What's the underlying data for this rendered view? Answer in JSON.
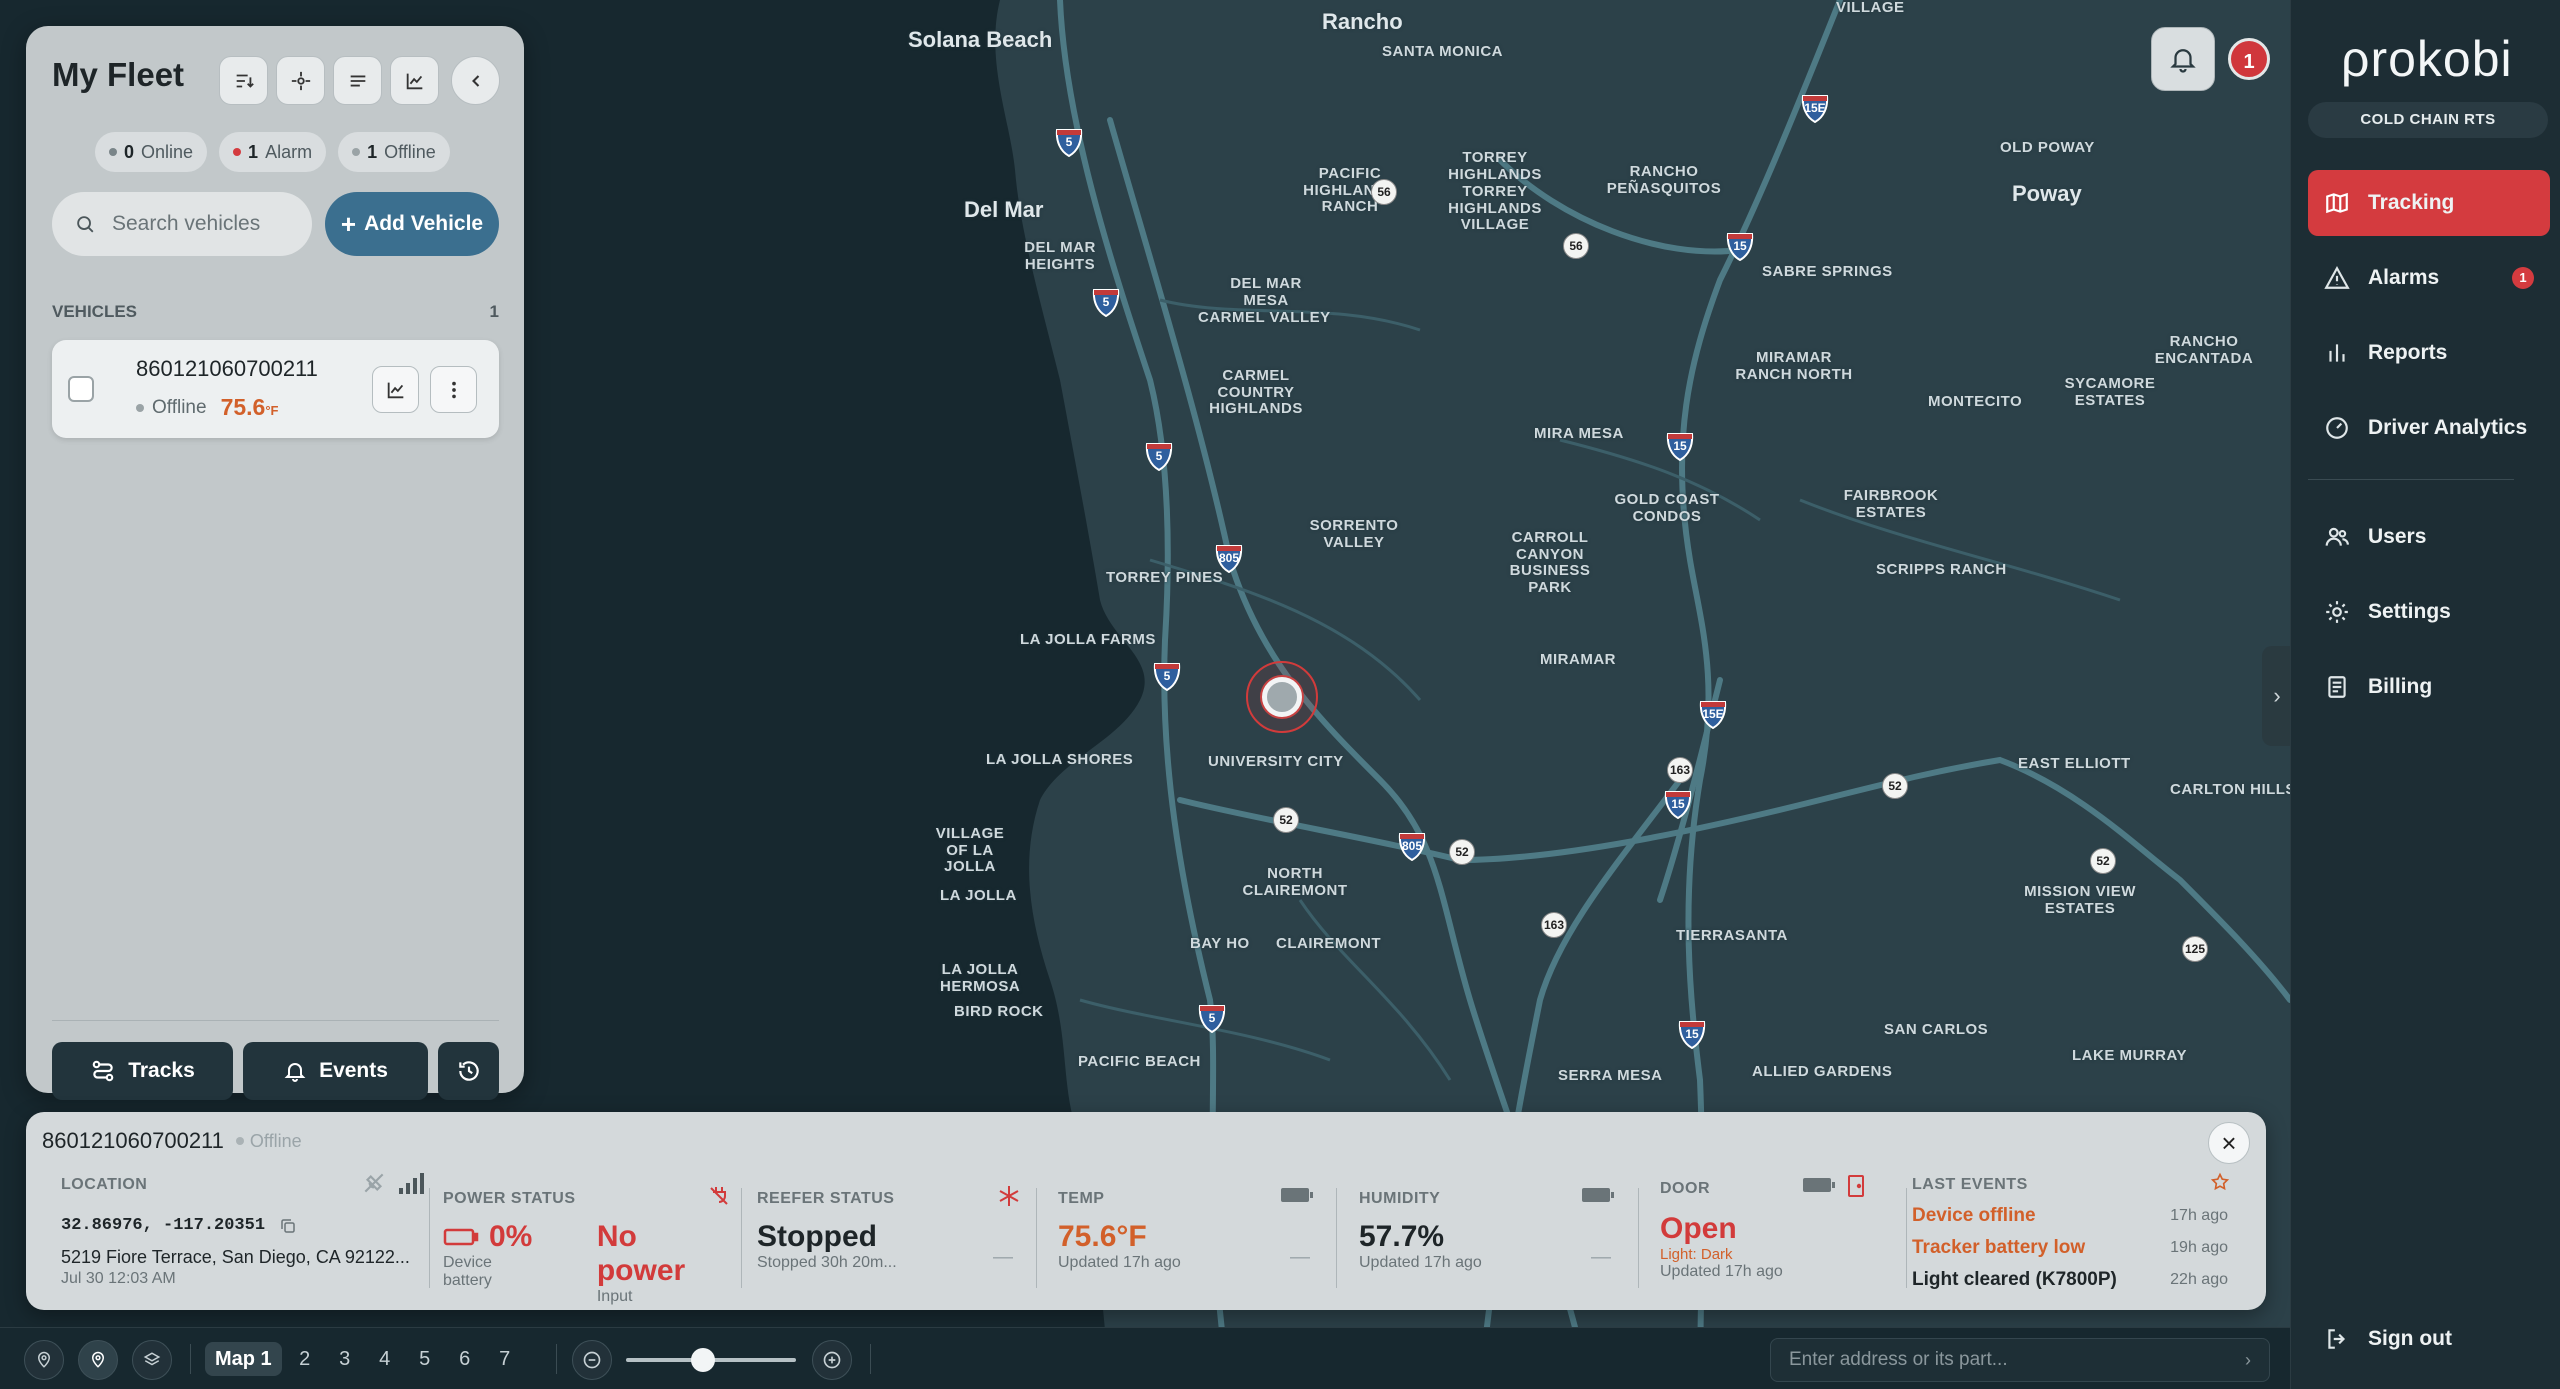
{
  "map": {
    "labels": [
      "Solana Beach",
      "Del Mar",
      "Rancho",
      "Santa Monica",
      "Pacific Highlands Ranch",
      "Torrey Highlands",
      "Torrey Highlands Village",
      "Rancho Peñasquitos",
      "Old Poway",
      "Poway",
      "Del Mar Heights",
      "Del Mar Mesa",
      "Carmel Valley",
      "Sabre Springs",
      "Rancho Encantada",
      "Miramar Ranch North",
      "Carmel Country Highlands",
      "Montecito",
      "Sycamore Estates",
      "Mira Mesa",
      "Gold Coast Condos",
      "Fairbrook Estates",
      "Sorrento Valley",
      "Carroll Canyon Business Park",
      "Torrey Pines",
      "Scripps Ranch",
      "La Jolla Farms",
      "Miramar",
      "La Jolla Shores",
      "University City",
      "East Elliott",
      "Carlton Hills",
      "Village of La Jolla",
      "North Clairemont",
      "Mission View Estates",
      "La Jolla",
      "Bay Ho",
      "Clairemont",
      "Tierrasanta",
      "La Jolla Hermosa",
      "Bird Rock",
      "San Carlos",
      "Pacific Beach",
      "Serra Mesa",
      "Allied Gardens",
      "Lake Murray",
      "Village"
    ],
    "interstates": [
      "5",
      "5",
      "5",
      "5",
      "5",
      "805",
      "805",
      "15",
      "15",
      "15",
      "15",
      "15E",
      "15E",
      "15E"
    ],
    "routes": [
      "56",
      "56",
      "163",
      "163",
      "52",
      "52",
      "52",
      "52",
      "125"
    ]
  },
  "header": {
    "alarm_count": "1"
  },
  "fleet": {
    "title": "My Fleet",
    "status": {
      "online_count": "0",
      "online_label": "Online",
      "alarm_count": "1",
      "alarm_label": "Alarm",
      "offline_count": "1",
      "offline_label": "Offline"
    },
    "search_placeholder": "Search vehicles",
    "add_label": "Add Vehicle",
    "section_label": "VEHICLES",
    "section_count": "1",
    "vehicles": [
      {
        "id": "860121060700211",
        "status": "Offline",
        "temp": "75.6",
        "temp_unit": "°F"
      }
    ],
    "tracks_label": "Tracks",
    "events_label": "Events"
  },
  "detail": {
    "title": "860121060700211",
    "status": "Offline",
    "location": {
      "label": "LOCATION",
      "coords": "32.86976, -117.20351",
      "address": "5219 Fiore Terrace, San Diego, CA 92122...",
      "time": "Jul 30 12:03 AM"
    },
    "power": {
      "label": "POWER STATUS",
      "battery_value": "0%",
      "battery_sub": "Device battery",
      "input_value": "No power",
      "input_sub": "Input"
    },
    "reefer": {
      "label": "REEFER STATUS",
      "value": "Stopped",
      "sub": "Stopped 30h 20m..."
    },
    "temp": {
      "label": "TEMP",
      "value": "75.6°F",
      "sub": "Updated 17h ago"
    },
    "humidity": {
      "label": "HUMIDITY",
      "value": "57.7%",
      "sub": "Updated 17h ago"
    },
    "door": {
      "label": "DOOR",
      "value": "Open",
      "light": "Light: Dark",
      "sub": "Updated 17h ago"
    },
    "events": {
      "label": "LAST EVENTS",
      "items": [
        {
          "text": "Device offline",
          "ago": "17h ago",
          "color": "#d2602a"
        },
        {
          "text": "Tracker battery low",
          "ago": "19h ago",
          "color": "#d2602a"
        },
        {
          "text": "Light cleared (K7800P)",
          "ago": "22h ago",
          "color": "#1e2528"
        }
      ]
    },
    "dash": "—"
  },
  "bottombar": {
    "tabs": [
      "Map 1",
      "2",
      "3",
      "4",
      "5",
      "6",
      "7"
    ],
    "active_tab": "Map 1",
    "zoom_level": 0.45,
    "address_placeholder": "Enter address or its part...",
    "address_arrow": "›"
  },
  "sidebar": {
    "brand": "ρrokobi",
    "company": "COLD CHAIN RTS",
    "nav": [
      {
        "label": "Tracking",
        "icon": "map-icon",
        "active": true
      },
      {
        "label": "Alarms",
        "icon": "alert-icon",
        "badge": "1"
      },
      {
        "label": "Reports",
        "icon": "bar-chart-icon"
      },
      {
        "label": "Driver Analytics",
        "icon": "gauge-icon"
      },
      {
        "label": "Users",
        "icon": "users-icon"
      },
      {
        "label": "Settings",
        "icon": "gear-icon"
      },
      {
        "label": "Billing",
        "icon": "receipt-icon"
      }
    ],
    "signout": "Sign out"
  },
  "colors": {
    "accent_red": "#d43b3f",
    "accent_blue": "#3b6f8f",
    "warning_orange": "#d2602a",
    "map_land": "#2c4149",
    "map_ocean": "#17282f"
  }
}
